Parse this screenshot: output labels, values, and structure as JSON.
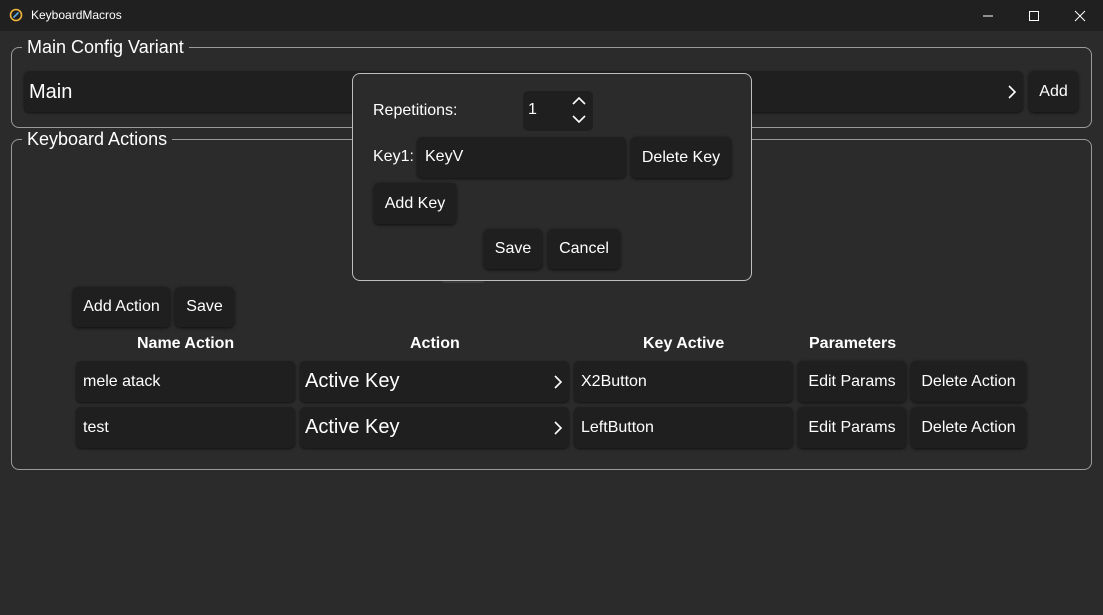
{
  "window": {
    "title": "KeyboardMacros",
    "controls": {
      "minimize": "minimize-icon",
      "maximize": "maximize-icon",
      "close": "close-icon"
    }
  },
  "main_config": {
    "legend": "Main Config Variant",
    "selected": "Main",
    "add_label": "Add"
  },
  "keyboard_actions": {
    "legend": "Keyboard Actions",
    "add_action_label": "Add Action",
    "save_label": "Save",
    "headers": {
      "name": "Name Action",
      "action": "Action",
      "key": "Key Active",
      "params": "Parameters"
    },
    "rows": [
      {
        "name": "mele atack",
        "action": "Active Key",
        "key": "X2Button",
        "edit": "Edit Params",
        "delete": "Delete Action"
      },
      {
        "name": "test",
        "action": "Active Key",
        "key": "LeftButton",
        "edit": "Edit Params",
        "delete": "Delete Action"
      }
    ]
  },
  "dialog": {
    "repetitions_label": "Repetitions:",
    "repetitions_value": "1",
    "key1_label": "Key1:",
    "key1_value": "KeyV",
    "delete_key_label": "Delete Key",
    "add_key_label": "Add Key",
    "save_label": "Save",
    "cancel_label": "Cancel"
  },
  "colors": {
    "background": "#2b2b2b",
    "titlebar": "#202020",
    "control": "#1f1f1f",
    "border": "#9a9a9a"
  }
}
